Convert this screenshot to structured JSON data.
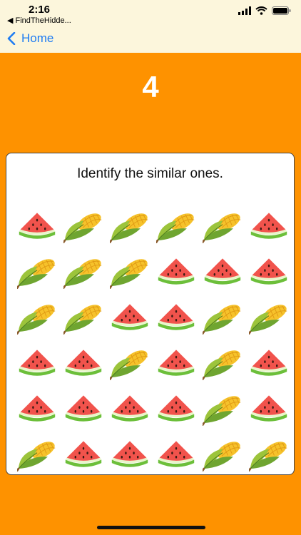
{
  "status": {
    "time": "2:16",
    "back_app": "◀ FindTheHidde..."
  },
  "nav": {
    "back_label": "Home"
  },
  "game": {
    "counter": "4",
    "prompt": "Identify the similar ones.",
    "grid": [
      [
        "watermelon",
        "corn",
        "corn",
        "corn",
        "corn",
        "watermelon"
      ],
      [
        "corn",
        "corn",
        "corn",
        "watermelon",
        "watermelon",
        "watermelon"
      ],
      [
        "corn",
        "corn",
        "watermelon",
        "watermelon",
        "corn",
        "corn"
      ],
      [
        "watermelon",
        "watermelon",
        "corn",
        "watermelon",
        "corn",
        "watermelon"
      ],
      [
        "watermelon",
        "watermelon",
        "watermelon",
        "watermelon",
        "corn",
        "watermelon"
      ],
      [
        "corn",
        "watermelon",
        "watermelon",
        "watermelon",
        "corn",
        "corn"
      ]
    ]
  },
  "colors": {
    "background": "#FE9200",
    "statusbar": "#FCF6DC",
    "link": "#1E7CF2"
  }
}
